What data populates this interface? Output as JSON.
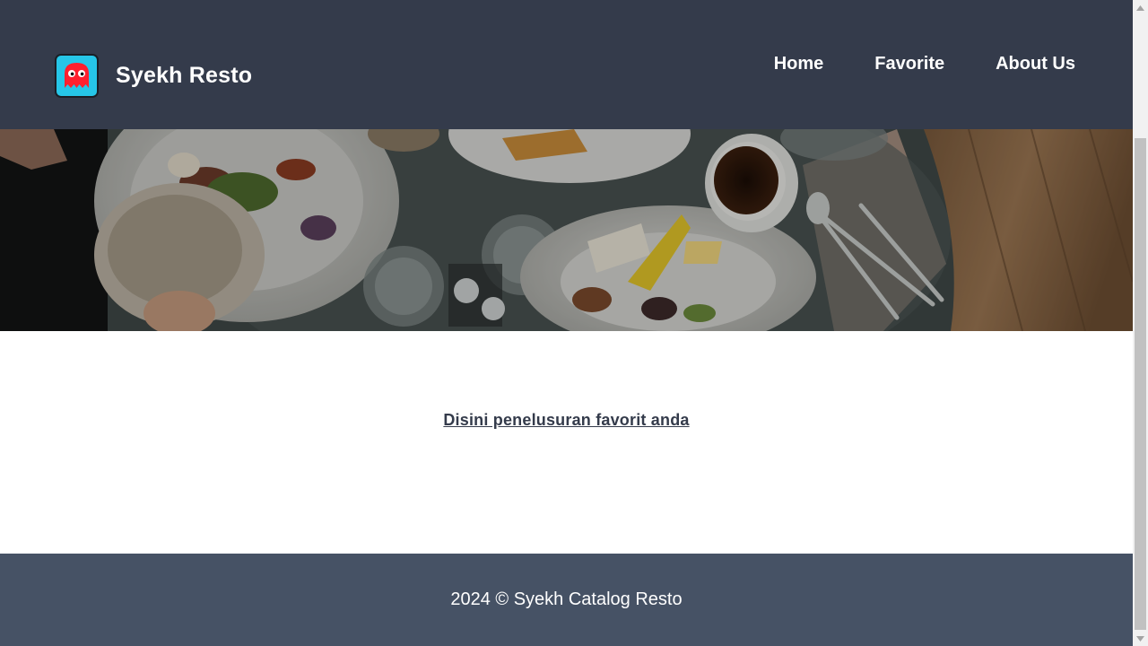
{
  "header": {
    "title": "Syekh Resto",
    "logo_icon": "ghost-icon",
    "nav": [
      {
        "label": "Home"
      },
      {
        "label": "Favorite"
      },
      {
        "label": "About Us"
      }
    ]
  },
  "hero": {
    "image": "restaurant-table-food-photo"
  },
  "content": {
    "link_text": "Disini penelusuran favorit anda"
  },
  "footer": {
    "text": "2024 © Syekh Catalog Resto"
  },
  "colors": {
    "header_bg": "#343b4b",
    "footer_bg": "#465265",
    "link": "#343b4b",
    "logo_tile": "#26c6e8",
    "ghost": "#ff1f2e"
  }
}
